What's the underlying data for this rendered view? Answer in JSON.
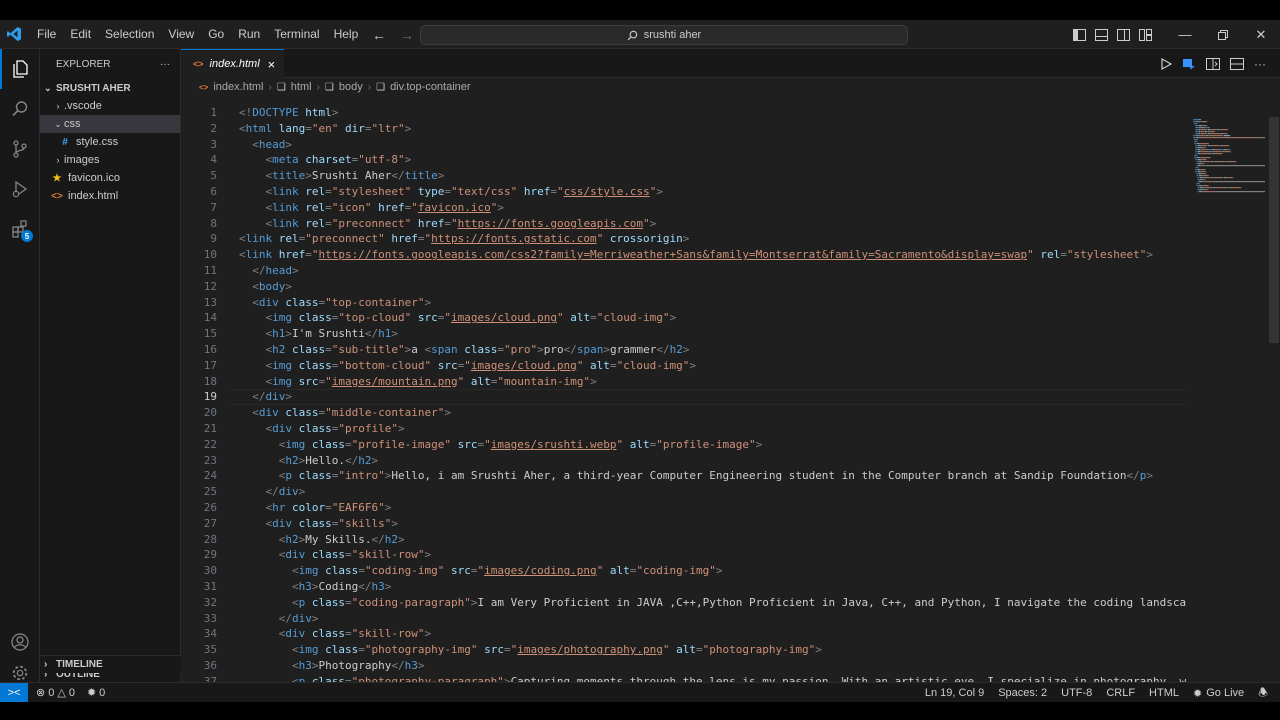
{
  "menu": [
    "File",
    "Edit",
    "Selection",
    "View",
    "Go",
    "Run",
    "Terminal",
    "Help"
  ],
  "search": {
    "text": "srushti aher"
  },
  "sidebar": {
    "title": "EXPLORER",
    "more": "···",
    "root": "SRUSHTI AHER",
    "items": [
      {
        "label": ".vscode",
        "kind": "folder",
        "depth": 1,
        "expanded": false
      },
      {
        "label": "css",
        "kind": "folder",
        "depth": 1,
        "expanded": true
      },
      {
        "label": "style.css",
        "kind": "css",
        "depth": 2
      },
      {
        "label": "images",
        "kind": "folder",
        "depth": 1,
        "expanded": false
      },
      {
        "label": "favicon.ico",
        "kind": "ico",
        "depth": 1
      },
      {
        "label": "index.html",
        "kind": "html",
        "depth": 1
      }
    ],
    "outline": "OUTLINE",
    "timeline": "TIMELINE"
  },
  "activity": {
    "extensions_badge": "5"
  },
  "tab": {
    "label": "index.html",
    "close": "×"
  },
  "breadcrumb": [
    "index.html",
    "html",
    "body",
    "div.top-container"
  ],
  "status": {
    "errors": "0",
    "warnings": "0",
    "ports": "0",
    "position": "Ln 19, Col 9",
    "spaces": "Spaces: 2",
    "encoding": "UTF-8",
    "eol": "CRLF",
    "language": "HTML",
    "golive": "Go Live"
  },
  "code": {
    "current_line": 19,
    "lines": [
      [
        [
          "p",
          "<!"
        ],
        [
          "t",
          "DOCTYPE"
        ],
        [
          "a",
          " html"
        ],
        [
          "p",
          ">"
        ]
      ],
      [
        [
          "p",
          "<"
        ],
        [
          "t",
          "html"
        ],
        [
          "a",
          " lang"
        ],
        [
          "p",
          "="
        ],
        [
          "s",
          "\"en\""
        ],
        [
          "a",
          " dir"
        ],
        [
          "p",
          "="
        ],
        [
          "s",
          "\"ltr\""
        ],
        [
          "p",
          ">"
        ]
      ],
      [
        [
          "p",
          "  <"
        ],
        [
          "t",
          "head"
        ],
        [
          "p",
          ">"
        ]
      ],
      [
        [
          "p",
          "    <"
        ],
        [
          "t",
          "meta"
        ],
        [
          "a",
          " charset"
        ],
        [
          "p",
          "="
        ],
        [
          "s",
          "\"utf-8\""
        ],
        [
          "p",
          ">"
        ]
      ],
      [
        [
          "p",
          "    <"
        ],
        [
          "t",
          "title"
        ],
        [
          "p",
          ">"
        ],
        [
          "x",
          "Srushti Aher"
        ],
        [
          "p",
          "</"
        ],
        [
          "t",
          "title"
        ],
        [
          "p",
          ">"
        ]
      ],
      [
        [
          "p",
          "    <"
        ],
        [
          "t",
          "link"
        ],
        [
          "a",
          " rel"
        ],
        [
          "p",
          "="
        ],
        [
          "s",
          "\"stylesheet\""
        ],
        [
          "a",
          " type"
        ],
        [
          "p",
          "="
        ],
        [
          "s",
          "\"text/css\""
        ],
        [
          "a",
          " href"
        ],
        [
          "p",
          "="
        ],
        [
          "s",
          "\""
        ],
        [
          "u",
          "css/style.css"
        ],
        [
          "s",
          "\""
        ],
        [
          "p",
          ">"
        ]
      ],
      [
        [
          "p",
          "    <"
        ],
        [
          "t",
          "link"
        ],
        [
          "a",
          " rel"
        ],
        [
          "p",
          "="
        ],
        [
          "s",
          "\"icon\""
        ],
        [
          "a",
          " href"
        ],
        [
          "p",
          "="
        ],
        [
          "s",
          "\""
        ],
        [
          "u",
          "favicon.ico"
        ],
        [
          "s",
          "\""
        ],
        [
          "p",
          ">"
        ]
      ],
      [
        [
          "p",
          "    <"
        ],
        [
          "t",
          "link"
        ],
        [
          "a",
          " rel"
        ],
        [
          "p",
          "="
        ],
        [
          "s",
          "\"preconnect\""
        ],
        [
          "a",
          " href"
        ],
        [
          "p",
          "="
        ],
        [
          "s",
          "\""
        ],
        [
          "u",
          "https://fonts.googleapis.com"
        ],
        [
          "s",
          "\""
        ],
        [
          "p",
          ">"
        ]
      ],
      [
        [
          "p",
          "<"
        ],
        [
          "t",
          "link"
        ],
        [
          "a",
          " rel"
        ],
        [
          "p",
          "="
        ],
        [
          "s",
          "\"preconnect\""
        ],
        [
          "a",
          " href"
        ],
        [
          "p",
          "="
        ],
        [
          "s",
          "\""
        ],
        [
          "u",
          "https://fonts.gstatic.com"
        ],
        [
          "s",
          "\""
        ],
        [
          "a",
          " crossorigin"
        ],
        [
          "p",
          ">"
        ]
      ],
      [
        [
          "p",
          "<"
        ],
        [
          "t",
          "link"
        ],
        [
          "a",
          " href"
        ],
        [
          "p",
          "="
        ],
        [
          "s",
          "\""
        ],
        [
          "u",
          "https://fonts.googleapis.com/css2?family=Merriweather+Sans&family=Montserrat&family=Sacramento&display=swap"
        ],
        [
          "s",
          "\""
        ],
        [
          "a",
          " rel"
        ],
        [
          "p",
          "="
        ],
        [
          "s",
          "\"stylesheet\""
        ],
        [
          "p",
          ">"
        ]
      ],
      [
        [
          "p",
          "  </"
        ],
        [
          "t",
          "head"
        ],
        [
          "p",
          ">"
        ]
      ],
      [
        [
          "p",
          "  <"
        ],
        [
          "t",
          "body"
        ],
        [
          "p",
          ">"
        ]
      ],
      [
        [
          "p",
          "  <"
        ],
        [
          "t",
          "div"
        ],
        [
          "a",
          " class"
        ],
        [
          "p",
          "="
        ],
        [
          "s",
          "\"top-container\""
        ],
        [
          "p",
          ">"
        ]
      ],
      [
        [
          "p",
          "    <"
        ],
        [
          "t",
          "img"
        ],
        [
          "a",
          " class"
        ],
        [
          "p",
          "="
        ],
        [
          "s",
          "\"top-cloud\""
        ],
        [
          "a",
          " src"
        ],
        [
          "p",
          "="
        ],
        [
          "s",
          "\""
        ],
        [
          "u",
          "images/cloud.png"
        ],
        [
          "s",
          "\""
        ],
        [
          "a",
          " alt"
        ],
        [
          "p",
          "="
        ],
        [
          "s",
          "\"cloud-img\""
        ],
        [
          "p",
          ">"
        ]
      ],
      [
        [
          "p",
          "    <"
        ],
        [
          "t",
          "h1"
        ],
        [
          "p",
          ">"
        ],
        [
          "x",
          "I'm Srushti"
        ],
        [
          "p",
          "</"
        ],
        [
          "t",
          "h1"
        ],
        [
          "p",
          ">"
        ]
      ],
      [
        [
          "p",
          "    <"
        ],
        [
          "t",
          "h2"
        ],
        [
          "a",
          " class"
        ],
        [
          "p",
          "="
        ],
        [
          "s",
          "\"sub-title\""
        ],
        [
          "p",
          ">"
        ],
        [
          "x",
          "a "
        ],
        [
          "p",
          "<"
        ],
        [
          "t",
          "span"
        ],
        [
          "a",
          " class"
        ],
        [
          "p",
          "="
        ],
        [
          "s",
          "\"pro\""
        ],
        [
          "p",
          ">"
        ],
        [
          "x",
          "pro"
        ],
        [
          "p",
          "</"
        ],
        [
          "t",
          "span"
        ],
        [
          "p",
          ">"
        ],
        [
          "x",
          "grammer"
        ],
        [
          "p",
          "</"
        ],
        [
          "t",
          "h2"
        ],
        [
          "p",
          ">"
        ]
      ],
      [
        [
          "p",
          "    <"
        ],
        [
          "t",
          "img"
        ],
        [
          "a",
          " class"
        ],
        [
          "p",
          "="
        ],
        [
          "s",
          "\"bottom-cloud\""
        ],
        [
          "a",
          " src"
        ],
        [
          "p",
          "="
        ],
        [
          "s",
          "\""
        ],
        [
          "u",
          "images/cloud.png"
        ],
        [
          "s",
          "\""
        ],
        [
          "a",
          " alt"
        ],
        [
          "p",
          "="
        ],
        [
          "s",
          "\"cloud-img\""
        ],
        [
          "p",
          ">"
        ]
      ],
      [
        [
          "p",
          "    <"
        ],
        [
          "t",
          "img"
        ],
        [
          "a",
          " src"
        ],
        [
          "p",
          "="
        ],
        [
          "s",
          "\""
        ],
        [
          "u",
          "images/mountain.png"
        ],
        [
          "s",
          "\""
        ],
        [
          "a",
          " alt"
        ],
        [
          "p",
          "="
        ],
        [
          "s",
          "\"mountain-img\""
        ],
        [
          "p",
          ">"
        ]
      ],
      [
        [
          "p",
          "  </"
        ],
        [
          "t",
          "div"
        ],
        [
          "p",
          ">"
        ]
      ],
      [
        [
          "p",
          "  <"
        ],
        [
          "t",
          "div"
        ],
        [
          "a",
          " class"
        ],
        [
          "p",
          "="
        ],
        [
          "s",
          "\"middle-container\""
        ],
        [
          "p",
          ">"
        ]
      ],
      [
        [
          "p",
          "    <"
        ],
        [
          "t",
          "div"
        ],
        [
          "a",
          " class"
        ],
        [
          "p",
          "="
        ],
        [
          "s",
          "\"profile\""
        ],
        [
          "p",
          ">"
        ]
      ],
      [
        [
          "p",
          "      <"
        ],
        [
          "t",
          "img"
        ],
        [
          "a",
          " class"
        ],
        [
          "p",
          "="
        ],
        [
          "s",
          "\"profile-image\""
        ],
        [
          "a",
          " src"
        ],
        [
          "p",
          "="
        ],
        [
          "s",
          "\""
        ],
        [
          "u",
          "images/srushti.webp"
        ],
        [
          "s",
          "\""
        ],
        [
          "a",
          " alt"
        ],
        [
          "p",
          "="
        ],
        [
          "s",
          "\"profile-image\""
        ],
        [
          "p",
          ">"
        ]
      ],
      [
        [
          "p",
          "      <"
        ],
        [
          "t",
          "h2"
        ],
        [
          "p",
          ">"
        ],
        [
          "x",
          "Hello."
        ],
        [
          "p",
          "</"
        ],
        [
          "t",
          "h2"
        ],
        [
          "p",
          ">"
        ]
      ],
      [
        [
          "p",
          "      <"
        ],
        [
          "t",
          "p"
        ],
        [
          "a",
          " class"
        ],
        [
          "p",
          "="
        ],
        [
          "s",
          "\"intro\""
        ],
        [
          "p",
          ">"
        ],
        [
          "x",
          "Hello, i am Srushti Aher, a third-year Computer Engineering student in the Computer branch at Sandip Foundation"
        ],
        [
          "p",
          "</"
        ],
        [
          "t",
          "p"
        ],
        [
          "p",
          ">"
        ]
      ],
      [
        [
          "p",
          "    </"
        ],
        [
          "t",
          "div"
        ],
        [
          "p",
          ">"
        ]
      ],
      [
        [
          "p",
          "    <"
        ],
        [
          "t",
          "hr"
        ],
        [
          "a",
          " color"
        ],
        [
          "p",
          "="
        ],
        [
          "s",
          "\"EAF6F6\""
        ],
        [
          "p",
          ">"
        ]
      ],
      [
        [
          "p",
          "    <"
        ],
        [
          "t",
          "div"
        ],
        [
          "a",
          " class"
        ],
        [
          "p",
          "="
        ],
        [
          "s",
          "\"skills\""
        ],
        [
          "p",
          ">"
        ]
      ],
      [
        [
          "p",
          "      <"
        ],
        [
          "t",
          "h2"
        ],
        [
          "p",
          ">"
        ],
        [
          "x",
          "My Skills."
        ],
        [
          "p",
          "</"
        ],
        [
          "t",
          "h2"
        ],
        [
          "p",
          ">"
        ]
      ],
      [
        [
          "p",
          "      <"
        ],
        [
          "t",
          "div"
        ],
        [
          "a",
          " class"
        ],
        [
          "p",
          "="
        ],
        [
          "s",
          "\"skill-row\""
        ],
        [
          "p",
          ">"
        ]
      ],
      [
        [
          "p",
          "        <"
        ],
        [
          "t",
          "img"
        ],
        [
          "a",
          " class"
        ],
        [
          "p",
          "="
        ],
        [
          "s",
          "\"coding-img\""
        ],
        [
          "a",
          " src"
        ],
        [
          "p",
          "="
        ],
        [
          "s",
          "\""
        ],
        [
          "u",
          "images/coding.png"
        ],
        [
          "s",
          "\""
        ],
        [
          "a",
          " alt"
        ],
        [
          "p",
          "="
        ],
        [
          "s",
          "\"coding-img\""
        ],
        [
          "p",
          ">"
        ]
      ],
      [
        [
          "p",
          "        <"
        ],
        [
          "t",
          "h3"
        ],
        [
          "p",
          ">"
        ],
        [
          "x",
          "Coding"
        ],
        [
          "p",
          "</"
        ],
        [
          "t",
          "h3"
        ],
        [
          "p",
          ">"
        ]
      ],
      [
        [
          "p",
          "        <"
        ],
        [
          "t",
          "p"
        ],
        [
          "a",
          " class"
        ],
        [
          "p",
          "="
        ],
        [
          "s",
          "\"coding-paragraph\""
        ],
        [
          "p",
          ">"
        ],
        [
          "x",
          "I am Very Proficient in JAVA ,C++,Python Proficient in Java, C++, and Python, I navigate the coding landscape wi"
        ]
      ],
      [
        [
          "p",
          "      </"
        ],
        [
          "t",
          "div"
        ],
        [
          "p",
          ">"
        ]
      ],
      [
        [
          "p",
          "      <"
        ],
        [
          "t",
          "div"
        ],
        [
          "a",
          " class"
        ],
        [
          "p",
          "="
        ],
        [
          "s",
          "\"skill-row\""
        ],
        [
          "p",
          ">"
        ]
      ],
      [
        [
          "p",
          "        <"
        ],
        [
          "t",
          "img"
        ],
        [
          "a",
          " class"
        ],
        [
          "p",
          "="
        ],
        [
          "s",
          "\"photography-img\""
        ],
        [
          "a",
          " src"
        ],
        [
          "p",
          "="
        ],
        [
          "s",
          "\""
        ],
        [
          "u",
          "images/photography.png"
        ],
        [
          "s",
          "\""
        ],
        [
          "a",
          " alt"
        ],
        [
          "p",
          "="
        ],
        [
          "s",
          "\"photography-img\""
        ],
        [
          "p",
          ">"
        ]
      ],
      [
        [
          "p",
          "        <"
        ],
        [
          "t",
          "h3"
        ],
        [
          "p",
          ">"
        ],
        [
          "x",
          "Photography"
        ],
        [
          "p",
          "</"
        ],
        [
          "t",
          "h3"
        ],
        [
          "p",
          ">"
        ]
      ],
      [
        [
          "p",
          "        <"
        ],
        [
          "t",
          "p"
        ],
        [
          "a",
          " class"
        ],
        [
          "p",
          "="
        ],
        [
          "s",
          "\"photography-paragraph\""
        ],
        [
          "p",
          ">"
        ],
        [
          "x",
          "Capturing moments through the lens is my passion. With an artistic eye, I specialize in photography, weavin"
        ]
      ]
    ]
  }
}
